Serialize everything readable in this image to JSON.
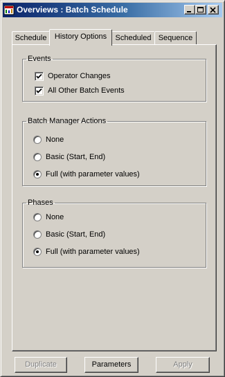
{
  "window": {
    "title": "Overviews : Batch Schedule"
  },
  "tabs": [
    {
      "label": "Schedule",
      "active": false
    },
    {
      "label": "History Options",
      "active": true
    },
    {
      "label": "Scheduled",
      "active": false
    },
    {
      "label": "Sequence",
      "active": false
    }
  ],
  "events": {
    "legend": "Events",
    "items": [
      {
        "label": "Operator Changes",
        "checked": true
      },
      {
        "label": "All Other Batch Events",
        "checked": true
      }
    ]
  },
  "batch_manager_actions": {
    "legend": "Batch Manager Actions",
    "options": [
      {
        "label": "None",
        "selected": false
      },
      {
        "label": "Basic (Start, End)",
        "selected": false
      },
      {
        "label": "Full (with parameter values)",
        "selected": true
      }
    ]
  },
  "phases": {
    "legend": "Phases",
    "options": [
      {
        "label": "None",
        "selected": false
      },
      {
        "label": "Basic (Start, End)",
        "selected": false
      },
      {
        "label": "Full (with parameter values)",
        "selected": true
      }
    ]
  },
  "buttons": {
    "duplicate": {
      "label": "Duplicate",
      "enabled": false
    },
    "parameters": {
      "label": "Parameters",
      "enabled": true
    },
    "apply": {
      "label": "Apply",
      "enabled": false
    }
  },
  "colors": {
    "title_bar_start": "#0a246a",
    "title_bar_end": "#a6caf0",
    "face": "#d4d0c8"
  }
}
